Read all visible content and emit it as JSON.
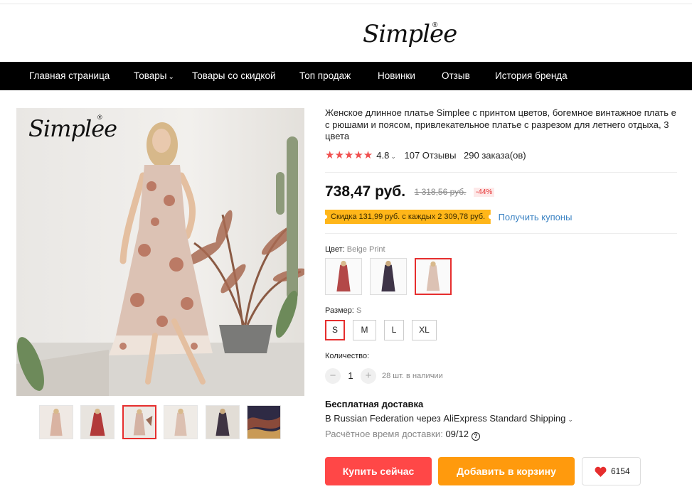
{
  "header": {
    "brand": "Simplee",
    "reg_mark": "®"
  },
  "nav": {
    "items": [
      {
        "label": "Главная страница"
      },
      {
        "label": "Товары",
        "has_dropdown": true
      },
      {
        "label": "Товары со скидкой"
      },
      {
        "label": "Топ продаж"
      },
      {
        "label": "Новинки"
      },
      {
        "label": "Отзыв"
      },
      {
        "label": "История бренда"
      }
    ]
  },
  "gallery": {
    "watermark": "Simplee",
    "reg_mark": "®",
    "selected_thumb": 2,
    "thumb_count": 6
  },
  "product": {
    "title": "Женское длинное платье Simplee с принтом цветов, богемное винтажное плать е с рюшами и поясом, привлекательное платье с разрезом для летнего отдыха, 3 цвета",
    "stars": "★★★★★",
    "rating": "4.8",
    "reviews": "107 Отзывы",
    "orders": "290 заказа(ов)",
    "price": "738,47 руб.",
    "old_price": "1 318,56 руб.",
    "discount": "-44%",
    "coupon_text": "Скидка 131,99 руб. с каждых 2 309,78 руб.",
    "coupon_link": "Получить купоны"
  },
  "options": {
    "color_label": "Цвет:",
    "color_value": "Beige Print",
    "colors": [
      "red-print",
      "navy-print",
      "beige-print"
    ],
    "selected_color": 2,
    "size_label": "Размер:",
    "size_value": "S",
    "sizes": [
      "S",
      "M",
      "L",
      "XL"
    ],
    "selected_size": 0,
    "qty_label": "Количество:",
    "qty_minus": "−",
    "qty_plus": "+",
    "qty": "1",
    "stock": "28 шт. в наличии"
  },
  "shipping": {
    "title": "Бесплатная доставка",
    "line": "В Russian Federation через AliExpress Standard Shipping",
    "eta_label": "Расчётное время доставки:",
    "eta_value": "09/12",
    "help": "?"
  },
  "actions": {
    "buy_now": "Купить сейчас",
    "add_to_cart": "Добавить в корзину",
    "wishlist_count": "6154"
  },
  "colors": {
    "accent_red": "#ff4747",
    "cart_orange": "#ff9a0d",
    "coupon_yellow": "#ffb619",
    "star_red": "#f04f4f",
    "link_blue": "#3d84c4"
  }
}
